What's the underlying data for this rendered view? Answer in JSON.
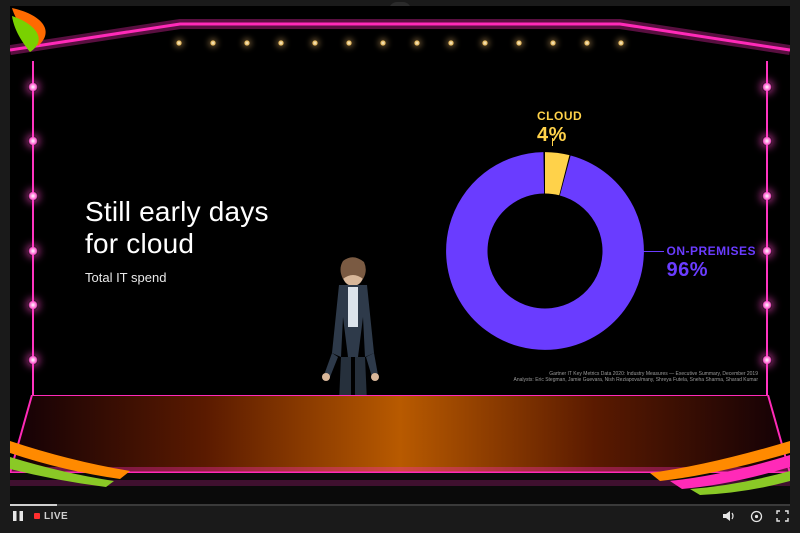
{
  "close_label": "×",
  "slide": {
    "title_line1": "Still early days",
    "title_line2": "for cloud",
    "subtitle": "Total IT spend"
  },
  "chart_data": {
    "type": "pie",
    "title": "Total IT spend",
    "series": [
      {
        "name": "CLOUD",
        "value": 4,
        "color": "#ffd24a"
      },
      {
        "name": "ON-PREMISES",
        "value": 96,
        "color": "#6a3cff"
      }
    ],
    "donut": true,
    "labels": {
      "cloud_name": "CLOUD",
      "cloud_pct": "4%",
      "onprem_name": "ON-PREMISES",
      "onprem_pct": "96%"
    }
  },
  "source": {
    "line1": "Gartner IT Key Metrics Data 2020: Industry Measures — Executive Summary, December 2019",
    "line2": "Analysts: Eric Stegman, Jamie Guevara, Nish Reziapova/many, Shreya Futela, Sneha Sharma, Sharad Kumar"
  },
  "player": {
    "live": "LIVE",
    "pause_icon": "pause",
    "volume_icon": "volume",
    "settings_icon": "settings",
    "fullscreen_icon": "fullscreen"
  }
}
